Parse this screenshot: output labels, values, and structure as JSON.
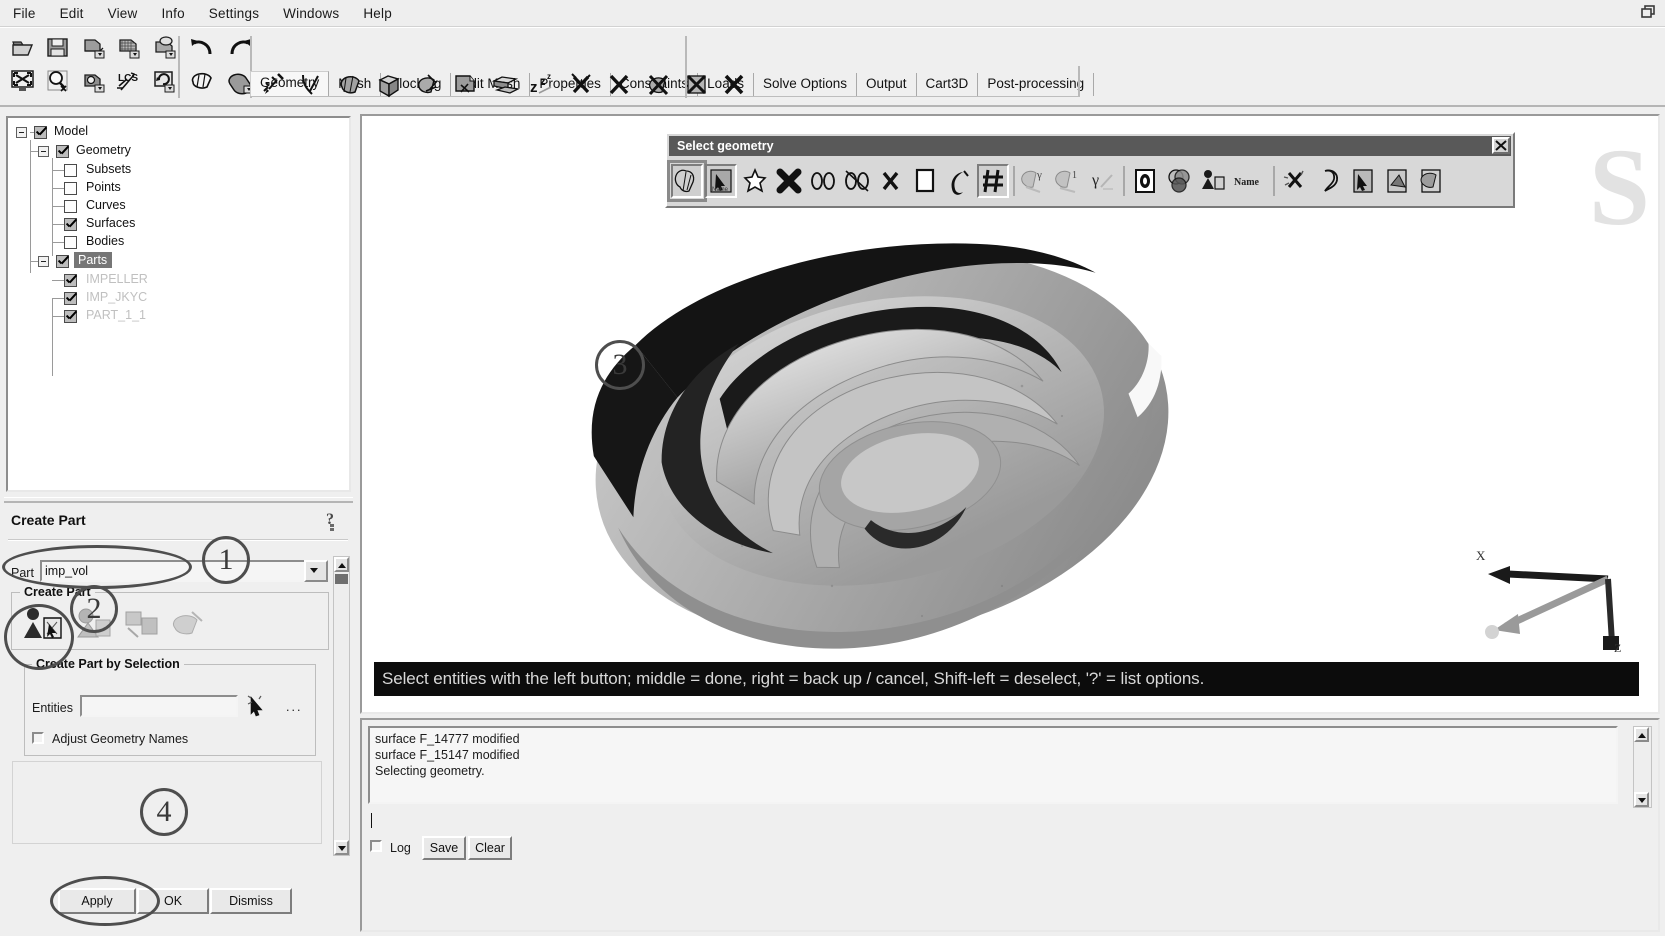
{
  "window": {
    "restore_icon": "restore-window-icon"
  },
  "menubar": {
    "items": [
      {
        "label": "File"
      },
      {
        "label": "Edit"
      },
      {
        "label": "View"
      },
      {
        "label": "Info"
      },
      {
        "label": "Settings"
      },
      {
        "label": "Windows"
      },
      {
        "label": "Help"
      }
    ]
  },
  "tabs": [
    {
      "label": "Geometry",
      "active": true
    },
    {
      "label": "Mesh",
      "active": false
    },
    {
      "label": "Blocking",
      "active": false
    },
    {
      "label": "Edit Mesh",
      "active": false
    },
    {
      "label": "Properties",
      "active": false
    },
    {
      "label": "Constraints",
      "active": false
    },
    {
      "label": "Loads",
      "active": false
    },
    {
      "label": "Solve Options",
      "active": false
    },
    {
      "label": "Output",
      "active": false
    },
    {
      "label": "Cart3D",
      "active": false
    },
    {
      "label": "Post-processing",
      "active": false
    }
  ],
  "file_toolbar": [
    {
      "icon": "open-folder-icon"
    },
    {
      "icon": "save-icon"
    },
    {
      "icon": "open-geometry-icon"
    },
    {
      "icon": "open-mesh-icon"
    },
    {
      "icon": "open-blocking-icon"
    },
    {
      "icon": "fit-to-screen-icon"
    },
    {
      "icon": "zoom-box-icon"
    },
    {
      "icon": "rotate-view-icon"
    },
    {
      "icon": "lcs-icon"
    },
    {
      "icon": "refresh-view-icon"
    }
  ],
  "undo_toolbar": [
    {
      "icon": "undo-icon"
    },
    {
      "icon": "redo-icon"
    },
    {
      "icon": "wireframe-display-icon"
    },
    {
      "icon": "solid-display-icon"
    }
  ],
  "geometry_toolbar": [
    {
      "icon": "create-point-icon"
    },
    {
      "icon": "create-curve-icon"
    },
    {
      "icon": "create-surface-icon"
    },
    {
      "icon": "create-body-icon"
    },
    {
      "icon": "repair-geometry-icon"
    },
    {
      "icon": "create-part-icon"
    },
    {
      "icon": "transform-geometry-icon"
    },
    {
      "icon": "restore-dormant-icon"
    },
    {
      "icon": "delete-point-icon"
    },
    {
      "icon": "delete-curve-icon"
    },
    {
      "icon": "delete-surface-icon"
    },
    {
      "icon": "delete-body-icon"
    },
    {
      "icon": "delete-any-icon"
    }
  ],
  "tree": {
    "nodes": [
      {
        "label": "Model",
        "depth": 0,
        "checked": true,
        "dim": false,
        "selected": false,
        "expander": true
      },
      {
        "label": "Geometry",
        "depth": 1,
        "checked": true,
        "dim": false,
        "selected": false,
        "expander": true
      },
      {
        "label": "Subsets",
        "depth": 2,
        "checked": false,
        "dim": false,
        "selected": false,
        "expander": false
      },
      {
        "label": "Points",
        "depth": 2,
        "checked": false,
        "dim": false,
        "selected": false,
        "expander": false
      },
      {
        "label": "Curves",
        "depth": 2,
        "checked": false,
        "dim": false,
        "selected": false,
        "expander": false
      },
      {
        "label": "Surfaces",
        "depth": 2,
        "checked": true,
        "dim": false,
        "selected": false,
        "expander": false
      },
      {
        "label": "Bodies",
        "depth": 2,
        "checked": false,
        "dim": false,
        "selected": false,
        "expander": false
      },
      {
        "label": "Parts",
        "depth": 1,
        "checked": true,
        "dim": false,
        "selected": true,
        "expander": true
      },
      {
        "label": "IMPELLER",
        "depth": 2,
        "checked": true,
        "dim": true,
        "selected": false,
        "expander": false
      },
      {
        "label": "IMP_JKYC",
        "depth": 2,
        "checked": true,
        "dim": true,
        "selected": false,
        "expander": false
      },
      {
        "label": "PART_1_1",
        "depth": 2,
        "checked": true,
        "dim": true,
        "selected": false,
        "expander": false
      }
    ]
  },
  "create_part": {
    "title": "Create Part",
    "help_icon": "help-question-icon",
    "part_label": "Part",
    "part_value": "imp_vol",
    "part_placeholder": "",
    "group_title": "Create Part",
    "mode_icons": [
      {
        "icon": "create-part-by-selection-icon",
        "selected": true
      },
      {
        "icon": "create-part-by-points-icon",
        "selected": false
      },
      {
        "icon": "create-assembly-icon",
        "selected": false
      },
      {
        "icon": "create-part-from-entities-icon",
        "selected": false
      }
    ],
    "selection_group_title": "Create Part by Selection",
    "entities_label": "Entities",
    "entities_value": "",
    "select_cursor_icon": "select-arrow-icon",
    "more_options": "...",
    "adjust_names_label": "Adjust Geometry Names",
    "adjust_names_checked": false,
    "buttons": [
      {
        "label": "Apply",
        "name": "apply-button"
      },
      {
        "label": "OK",
        "name": "ok-button"
      },
      {
        "label": "Dismiss",
        "name": "dismiss-button"
      }
    ]
  },
  "select_geometry": {
    "title": "Select geometry",
    "close_icon": "close-icon",
    "tools": [
      {
        "icon": "select-all-appropriate-icon",
        "pressed": true,
        "outlined": true
      },
      {
        "icon": "select-items-in-part-icon",
        "pressed": true,
        "outlined": false
      },
      {
        "icon": "select-points-icon",
        "pressed": false,
        "outlined": false
      },
      {
        "icon": "select-curves-icon",
        "pressed": false,
        "outlined": false
      },
      {
        "icon": "select-surfaces-icon",
        "pressed": false,
        "outlined": false
      },
      {
        "icon": "select-bodies-icon",
        "pressed": false,
        "outlined": false
      },
      {
        "icon": "deselect-icon",
        "pressed": false,
        "outlined": false
      },
      {
        "icon": "box-select-icon",
        "pressed": false,
        "outlined": false
      },
      {
        "icon": "polygon-select-icon",
        "pressed": false,
        "outlined": false
      },
      {
        "icon": "grid-select-icon",
        "pressed": true,
        "outlined": false
      },
      {
        "icon": "select-by-attribute-y-icon",
        "pressed": false,
        "outlined": false
      },
      {
        "icon": "select-by-attribute-1-icon",
        "pressed": false,
        "outlined": false
      },
      {
        "icon": "select-gamma-icon",
        "pressed": false,
        "outlined": false
      },
      {
        "icon": "select-loop-icon",
        "pressed": false,
        "outlined": false
      },
      {
        "icon": "select-venn-icon",
        "pressed": false,
        "outlined": false
      },
      {
        "icon": "select-part-icon",
        "pressed": false,
        "outlined": false
      },
      {
        "icon": "select-by-name-icon",
        "pressed": false,
        "outlined": false
      },
      {
        "icon": "select-toggle-icon",
        "pressed": false,
        "outlined": false
      },
      {
        "icon": "select-unselect-icon",
        "pressed": false,
        "outlined": false
      },
      {
        "icon": "select-previous-icon",
        "pressed": false,
        "outlined": false
      },
      {
        "icon": "select-next-icon",
        "pressed": false,
        "outlined": false
      },
      {
        "icon": "select-done-icon",
        "pressed": false,
        "outlined": false
      }
    ]
  },
  "viewport": {
    "watermark": "S",
    "status_message": "Select entities with the left button; middle = done, right = back up / cancel, Shift-left = deselect, '?' = list options.",
    "axis_labels": {
      "x": "X",
      "z": "Z"
    }
  },
  "log": {
    "lines": [
      "surface F_14777 modified",
      "surface F_15147 modified",
      "Selecting geometry."
    ],
    "log_checkbox_label": "Log",
    "log_checked": false,
    "save_label": "Save",
    "clear_label": "Clear"
  },
  "annotations": [
    {
      "number": "1"
    },
    {
      "number": "2"
    },
    {
      "number": "3"
    },
    {
      "number": "4"
    }
  ]
}
